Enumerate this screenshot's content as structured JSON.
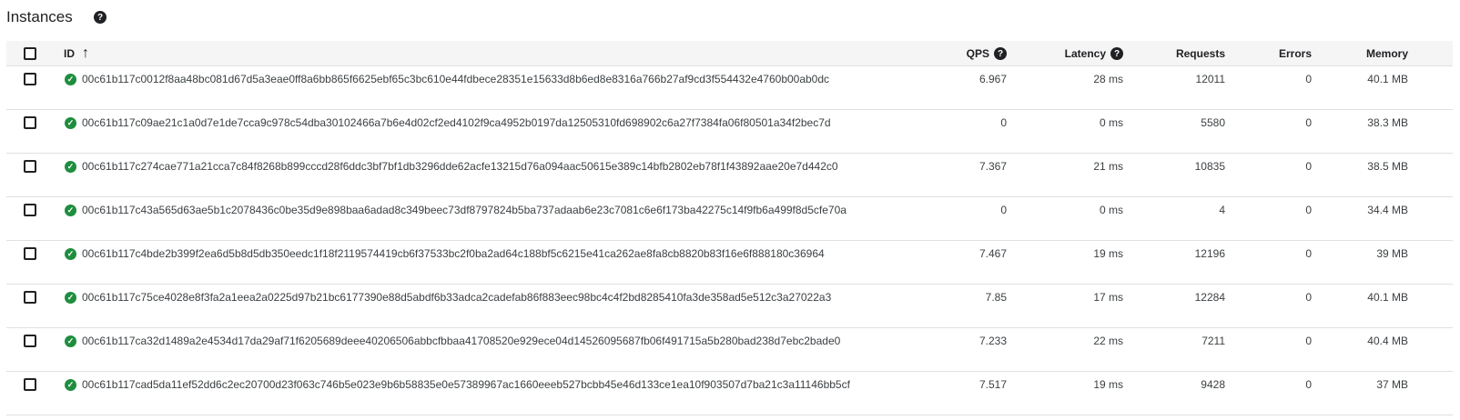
{
  "header": {
    "title": "Instances",
    "help_icon": "help-icon"
  },
  "columns": {
    "id": "ID",
    "qps": "QPS",
    "latency": "Latency",
    "requests": "Requests",
    "errors": "Errors",
    "memory": "Memory"
  },
  "sort": {
    "column": "ID",
    "direction": "ascending",
    "icon": "arrow-up-icon"
  },
  "rows": [
    {
      "id": "00c61b117c0012f8aa48bc081d67d5a3eae0ff8a6bb865f6625ebf65c3bc610e44fdbece28351e15633d8b6ed8e8316a766b27af9cd3f554432e4760b00ab0dc",
      "qps": "6.967",
      "latency": "28 ms",
      "requests": "12011",
      "errors": "0",
      "memory": "40.1 MB"
    },
    {
      "id": "00c61b117c09ae21c1a0d7e1de7cca9c978c54dba30102466a7b6e4d02cf2ed4102f9ca4952b0197da12505310fd698902c6a27f7384fa06f80501a34f2bec7d",
      "qps": "0",
      "latency": "0 ms",
      "requests": "5580",
      "errors": "0",
      "memory": "38.3 MB"
    },
    {
      "id": "00c61b117c274cae771a21cca7c84f8268b899cccd28f6ddc3bf7bf1db3296dde62acfe13215d76a094aac50615e389c14bfb2802eb78f1f43892aae20e7d442c0",
      "qps": "7.367",
      "latency": "21 ms",
      "requests": "10835",
      "errors": "0",
      "memory": "38.5 MB"
    },
    {
      "id": "00c61b117c43a565d63ae5b1c2078436c0be35d9e898baa6adad8c349beec73df8797824b5ba737adaab6e23c7081c6e6f173ba42275c14f9fb6a499f8d5cfe70a",
      "qps": "0",
      "latency": "0 ms",
      "requests": "4",
      "errors": "0",
      "memory": "34.4 MB"
    },
    {
      "id": "00c61b117c4bde2b399f2ea6d5b8d5db350eedc1f18f2119574419cb6f37533bc2f0ba2ad64c188bf5c6215e41ca262ae8fa8cb8820b83f16e6f888180c36964",
      "qps": "7.467",
      "latency": "19 ms",
      "requests": "12196",
      "errors": "0",
      "memory": "39 MB"
    },
    {
      "id": "00c61b117c75ce4028e8f3fa2a1eea2a0225d97b21bc6177390e88d5abdf6b33adca2cadefab86f883eec98bc4c4f2bd8285410fa3de358ad5e512c3a27022a3",
      "qps": "7.85",
      "latency": "17 ms",
      "requests": "12284",
      "errors": "0",
      "memory": "40.1 MB"
    },
    {
      "id": "00c61b117ca32d1489a2e4534d17da29af71f6205689deee40206506abbcfbbaa41708520e929ece04d14526095687fb06f491715a5b280bad238d7ebc2bade0",
      "qps": "7.233",
      "latency": "22 ms",
      "requests": "7211",
      "errors": "0",
      "memory": "40.4 MB"
    },
    {
      "id": "00c61b117cad5da11ef52dd6c2ec20700d23f063c746b5e023e9b6b58835e0e57389967ac1660eeeb527bcbb45e46d133ce1ea10f903507d7ba21c3a11146bb5cf",
      "qps": "7.517",
      "latency": "19 ms",
      "requests": "9428",
      "errors": "0",
      "memory": "37 MB"
    }
  ],
  "colors": {
    "status_ok": "#1e8e3e",
    "header_bg": "#f5f5f5",
    "divider": "#e0e0e0"
  }
}
